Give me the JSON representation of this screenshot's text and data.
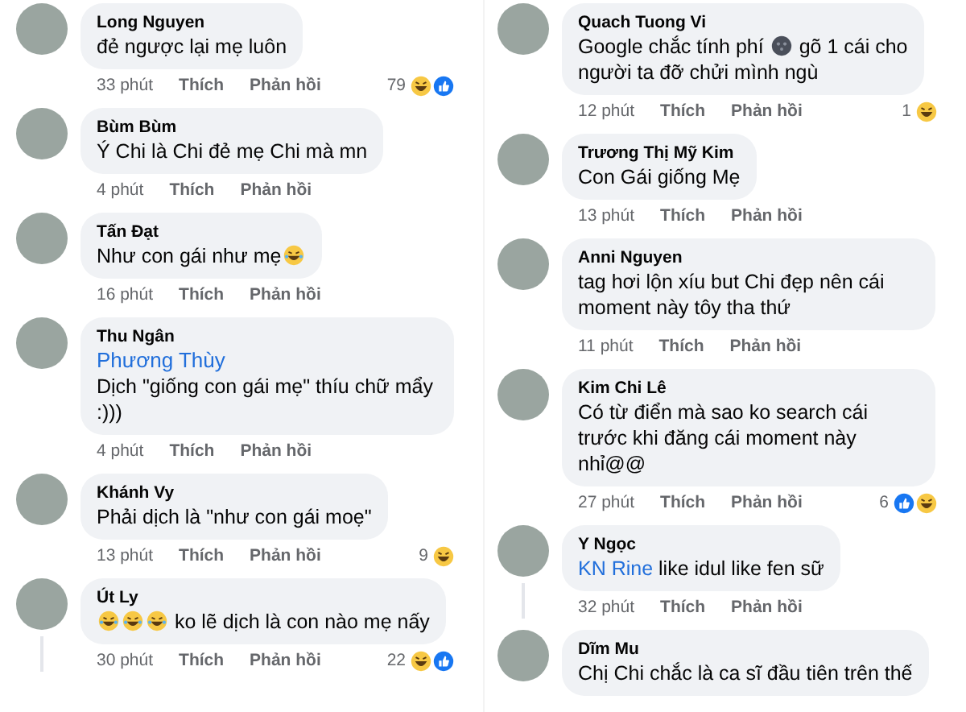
{
  "columns": [
    {
      "comments": [
        {
          "name": "Long Nguyen",
          "body": [
            {
              "kind": "text",
              "text": "đẻ ngược lại mẹ luôn"
            }
          ],
          "time": "33 phút",
          "like": "Thích",
          "reply": "Phản hồi",
          "reactions": {
            "count": "79",
            "icons": [
              {
                "kind": "haha"
              },
              {
                "kind": "like"
              }
            ]
          },
          "thread": false
        },
        {
          "name": "Bùm Bùm",
          "body": [
            {
              "kind": "text",
              "text": "Ý Chi là Chi đẻ mẹ Chi mà mn"
            }
          ],
          "time": "4 phút",
          "like": "Thích",
          "reply": "Phản hồi",
          "thread": false
        },
        {
          "name": "Tấn Đạt",
          "body": [
            {
              "kind": "text",
              "text": "Như con gái như mẹ"
            },
            {
              "kind": "laugh"
            }
          ],
          "time": "16 phút",
          "like": "Thích",
          "reply": "Phản hồi",
          "thread": false
        },
        {
          "name": "Thu Ngân",
          "body": [
            {
              "kind": "mention-line",
              "text": "Phương Thùy"
            },
            {
              "kind": "text",
              "text": "Dịch \"giống con gái mẹ\" thíu chữ mẩy :)))"
            }
          ],
          "time": "4 phút",
          "like": "Thích",
          "reply": "Phản hồi",
          "thread": false
        },
        {
          "name": "Khánh Vy",
          "body": [
            {
              "kind": "text",
              "text": "Phải dịch là \"như con gái moẹ\""
            }
          ],
          "time": "13 phút",
          "like": "Thích",
          "reply": "Phản hồi",
          "reactions": {
            "count": "9",
            "icons": [
              {
                "kind": "haha"
              }
            ]
          },
          "thread": false
        },
        {
          "name": "Út Ly",
          "body": [
            {
              "kind": "laugh"
            },
            {
              "kind": "laugh"
            },
            {
              "kind": "laugh"
            },
            {
              "kind": "text",
              "text": " ko lẽ dịch là con nào mẹ nấy"
            }
          ],
          "time": "30 phút",
          "like": "Thích",
          "reply": "Phản hồi",
          "reactions": {
            "count": "22",
            "icons": [
              {
                "kind": "haha"
              },
              {
                "kind": "like"
              }
            ]
          },
          "thread": true
        }
      ]
    },
    {
      "comments": [
        {
          "name": "Quach Tuong Vi",
          "body": [
            {
              "kind": "text",
              "text": "Google chắc tính phí "
            },
            {
              "kind": "moon"
            },
            {
              "kind": "text",
              "text": " gõ 1 cái cho"
            },
            {
              "kind": "line",
              "text": "người ta đỡ chửi mình ngù"
            }
          ],
          "time": "12 phút",
          "like": "Thích",
          "reply": "Phản hồi",
          "reactions": {
            "count": "1",
            "icons": [
              {
                "kind": "haha"
              }
            ]
          },
          "thread": false
        },
        {
          "name": "Trương Thị Mỹ Kim",
          "body": [
            {
              "kind": "text",
              "text": "Con Gái giống Mẹ"
            }
          ],
          "time": "13 phút",
          "like": "Thích",
          "reply": "Phản hồi",
          "thread": false
        },
        {
          "name": "Anni Nguyen",
          "body": [
            {
              "kind": "text",
              "text": "tag hơi lộn xíu but Chi đẹp nên cái moment này tôy tha thứ"
            }
          ],
          "time": "11 phút",
          "like": "Thích",
          "reply": "Phản hồi",
          "thread": false
        },
        {
          "name": "Kim Chi Lê",
          "body": [
            {
              "kind": "text",
              "text": "Có từ điển mà sao ko search cái trước khi đăng cái moment này nhỉ@@"
            }
          ],
          "time": "27 phút",
          "like": "Thích",
          "reply": "Phản hồi",
          "reactions": {
            "count": "6",
            "icons": [
              {
                "kind": "like"
              },
              {
                "kind": "haha"
              }
            ]
          },
          "thread": false
        },
        {
          "name": "Y Ngọc",
          "body": [
            {
              "kind": "mention",
              "text": "KN Rine"
            },
            {
              "kind": "text",
              "text": " like idul like fen sữ"
            }
          ],
          "time": "32 phút",
          "like": "Thích",
          "reply": "Phản hồi",
          "thread": true
        },
        {
          "name": "Dĩm Mu",
          "body": [
            {
              "kind": "text",
              "text": "Chị Chi chắc là ca sĩ đầu tiên trên thế"
            }
          ],
          "thread": false
        }
      ]
    }
  ]
}
